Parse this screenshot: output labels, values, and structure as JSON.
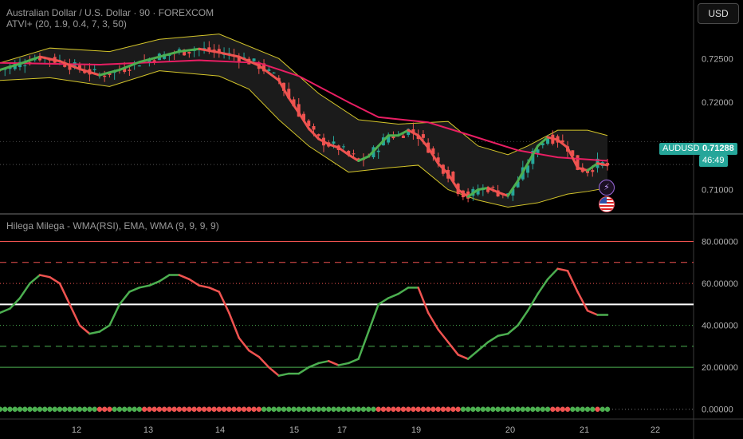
{
  "header": {
    "title": "Australian Dollar / U.S. Dollar · 90 · FOREXCOM",
    "indicator_top": "ATVI+ (20, 1.9, 0.4, 7, 3, 50)",
    "indicator_bottom": "Hilega Milega - WMA(RSI), EMA, WMA (9, 9, 9, 9)"
  },
  "currency_button": "USD",
  "price_badge": {
    "symbol": "AUDUSD",
    "price": "0.71288",
    "countdown": "46:49"
  },
  "icons": {
    "event": "lightning-icon",
    "country": "us-flag-icon"
  },
  "colors": {
    "bg": "#000000",
    "up": "#26a69a",
    "down": "#ef5350",
    "bands": "#d4c52a",
    "band_fill": "#1b1b1b",
    "slow_ma": "#e91e63",
    "fast_ma_up": "#4caf50",
    "fast_ma_down": "#ef5350",
    "rsi_mid": "#ffffff",
    "grid": "#333333"
  },
  "chart_data": [
    {
      "type": "candlestick",
      "title": "Australian Dollar / U.S. Dollar · 90 · FOREXCOM",
      "ylim": [
        0.7075,
        0.7285
      ],
      "yticks": [
        0.725,
        0.72,
        0.715,
        0.71
      ],
      "ytick_labels": [
        "0.72500",
        "0.72000",
        "0.71500",
        "0.71000"
      ],
      "xticks": [
        "12",
        "13",
        "14",
        "15",
        "17",
        "19",
        "20",
        "21",
        "22"
      ],
      "current_price": 0.71288,
      "close_path": [
        [
          0,
          0.7237
        ],
        [
          4,
          0.7244
        ],
        [
          8,
          0.7252
        ],
        [
          12,
          0.7247
        ],
        [
          16,
          0.7238
        ],
        [
          20,
          0.7231
        ],
        [
          24,
          0.7237
        ],
        [
          28,
          0.7246
        ],
        [
          32,
          0.7252
        ],
        [
          36,
          0.7258
        ],
        [
          40,
          0.7261
        ],
        [
          44,
          0.7257
        ],
        [
          48,
          0.7252
        ],
        [
          52,
          0.7242
        ],
        [
          56,
          0.7225
        ],
        [
          58,
          0.7205
        ],
        [
          60,
          0.7188
        ],
        [
          62,
          0.717
        ],
        [
          64,
          0.7158
        ],
        [
          66,
          0.7152
        ],
        [
          68,
          0.7148
        ],
        [
          70,
          0.714
        ],
        [
          72,
          0.7133
        ],
        [
          74,
          0.7138
        ],
        [
          76,
          0.715
        ],
        [
          78,
          0.7162
        ],
        [
          80,
          0.7162
        ],
        [
          82,
          0.7168
        ],
        [
          84,
          0.7162
        ],
        [
          86,
          0.7148
        ],
        [
          88,
          0.713
        ],
        [
          90,
          0.7118
        ],
        [
          92,
          0.71
        ],
        [
          94,
          0.7092
        ],
        [
          96,
          0.71
        ],
        [
          98,
          0.7102
        ],
        [
          100,
          0.7097
        ],
        [
          102,
          0.7093
        ],
        [
          104,
          0.711
        ],
        [
          106,
          0.713
        ],
        [
          108,
          0.715
        ],
        [
          110,
          0.716
        ],
        [
          112,
          0.7157
        ],
        [
          114,
          0.7148
        ],
        [
          116,
          0.7125
        ],
        [
          118,
          0.7122
        ],
        [
          120,
          0.713
        ],
        [
          122,
          0.7128
        ]
      ],
      "bollinger_upper": [
        [
          0,
          0.7245
        ],
        [
          10,
          0.7262
        ],
        [
          22,
          0.7258
        ],
        [
          32,
          0.7272
        ],
        [
          44,
          0.7278
        ],
        [
          56,
          0.725
        ],
        [
          64,
          0.721
        ],
        [
          72,
          0.718
        ],
        [
          80,
          0.7175
        ],
        [
          90,
          0.7178
        ],
        [
          96,
          0.715
        ],
        [
          102,
          0.714
        ],
        [
          106,
          0.715
        ],
        [
          112,
          0.7168
        ],
        [
          118,
          0.7168
        ],
        [
          122,
          0.7162
        ]
      ],
      "bollinger_lower": [
        [
          0,
          0.7225
        ],
        [
          10,
          0.7228
        ],
        [
          22,
          0.7218
        ],
        [
          32,
          0.7236
        ],
        [
          44,
          0.723
        ],
        [
          50,
          0.7215
        ],
        [
          56,
          0.718
        ],
        [
          62,
          0.715
        ],
        [
          70,
          0.712
        ],
        [
          78,
          0.7125
        ],
        [
          84,
          0.7128
        ],
        [
          90,
          0.71
        ],
        [
          96,
          0.7088
        ],
        [
          102,
          0.708
        ],
        [
          108,
          0.7085
        ],
        [
          114,
          0.7095
        ],
        [
          118,
          0.7098
        ],
        [
          122,
          0.7102
        ]
      ],
      "slow_ma": [
        [
          0,
          0.7245
        ],
        [
          20,
          0.7243
        ],
        [
          40,
          0.7248
        ],
        [
          52,
          0.7245
        ],
        [
          60,
          0.723
        ],
        [
          70,
          0.72
        ],
        [
          76,
          0.7183
        ],
        [
          86,
          0.7177
        ],
        [
          94,
          0.7163
        ],
        [
          104,
          0.7145
        ],
        [
          112,
          0.7137
        ],
        [
          122,
          0.7133
        ]
      ]
    },
    {
      "type": "line",
      "title": "Hilega Milega - WMA(RSI), EMA, WMA (9, 9, 9, 9)",
      "ylim": [
        -2,
        84
      ],
      "yticks": [
        80,
        60,
        40,
        20,
        0
      ],
      "ytick_labels": [
        "80.00000",
        "60.00000",
        "40.00000",
        "20.00000",
        "0.00000"
      ],
      "levels": [
        80,
        70,
        60,
        50,
        40,
        30,
        20,
        0
      ],
      "series": [
        {
          "values": [
            [
              0,
              46
            ],
            [
              2,
              48
            ],
            [
              4,
              53
            ],
            [
              6,
              60
            ],
            [
              8,
              64
            ],
            [
              10,
              63
            ],
            [
              12,
              60
            ],
            [
              14,
              50
            ],
            [
              16,
              40
            ],
            [
              18,
              36
            ],
            [
              20,
              37
            ],
            [
              22,
              40
            ],
            [
              24,
              50
            ],
            [
              26,
              56
            ],
            [
              28,
              58
            ],
            [
              30,
              59
            ],
            [
              32,
              61
            ],
            [
              34,
              64
            ],
            [
              36,
              64
            ],
            [
              38,
              62
            ],
            [
              40,
              59
            ],
            [
              42,
              58
            ],
            [
              44,
              56
            ],
            [
              46,
              46
            ],
            [
              48,
              34
            ],
            [
              50,
              28
            ],
            [
              52,
              25
            ],
            [
              54,
              20
            ],
            [
              56,
              16
            ],
            [
              58,
              17
            ],
            [
              60,
              17
            ],
            [
              62,
              20
            ],
            [
              64,
              22
            ],
            [
              66,
              23
            ],
            [
              68,
              21
            ],
            [
              70,
              22
            ],
            [
              72,
              24
            ],
            [
              74,
              37
            ],
            [
              76,
              50
            ],
            [
              78,
              53
            ],
            [
              80,
              55
            ],
            [
              82,
              58
            ],
            [
              84,
              58
            ],
            [
              86,
              46
            ],
            [
              88,
              38
            ],
            [
              90,
              32
            ],
            [
              92,
              26
            ],
            [
              94,
              24
            ],
            [
              96,
              28
            ],
            [
              98,
              32
            ],
            [
              100,
              35
            ],
            [
              102,
              36
            ],
            [
              104,
              40
            ],
            [
              106,
              47
            ],
            [
              108,
              55
            ],
            [
              110,
              62
            ],
            [
              112,
              67
            ],
            [
              114,
              66
            ],
            [
              116,
              56
            ],
            [
              118,
              47
            ],
            [
              120,
              45
            ],
            [
              122,
              45
            ]
          ]
        }
      ]
    }
  ]
}
